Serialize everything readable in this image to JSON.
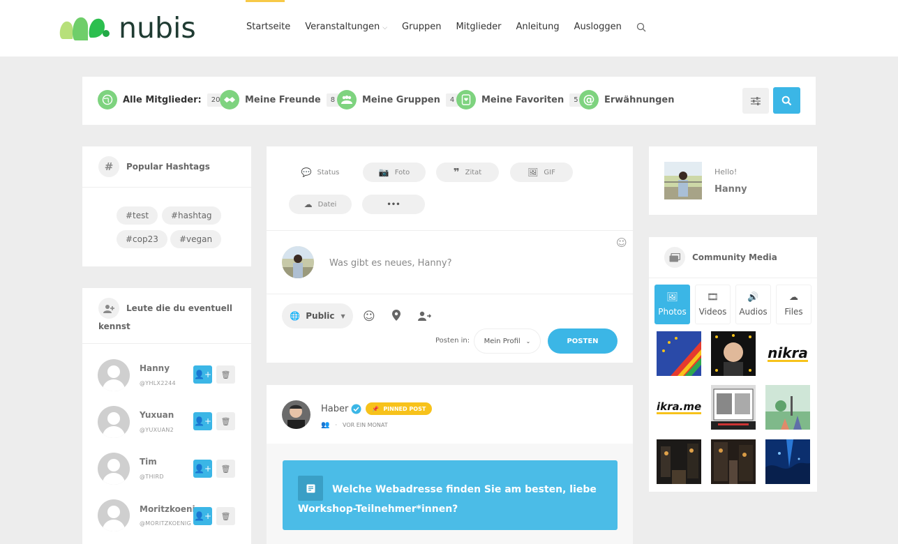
{
  "header": {
    "logo_text": "nubis",
    "nav": [
      {
        "label": "Startseite"
      },
      {
        "label": "Veranstaltungen",
        "has_dropdown": true
      },
      {
        "label": "Gruppen"
      },
      {
        "label": "Mitglieder"
      },
      {
        "label": "Anleitung"
      },
      {
        "label": "Ausloggen"
      }
    ],
    "search_icon": "search-icon",
    "accent": "#f7c948"
  },
  "members_bar": {
    "items": [
      {
        "label": "Alle Mitglieder:",
        "count": "20",
        "icon": "globe-icon"
      },
      {
        "label": "Meine Freunde",
        "count": "8",
        "icon": "handshake-icon"
      },
      {
        "label": "Meine Gruppen",
        "count": "4",
        "icon": "group-icon"
      },
      {
        "label": "Meine Favoriten",
        "count": "5",
        "icon": "favorite-icon"
      },
      {
        "label": "Erwähnungen",
        "icon": "at-icon"
      }
    ],
    "filter_icon": "sliders-icon",
    "search_icon": "search-icon",
    "accent_green": "#7ed37f",
    "accent_blue": "#3bb6e6"
  },
  "hashtags": {
    "title": "Popular Hashtags",
    "tags": [
      "#test",
      "#hashtag",
      "#cop23",
      "#vegan"
    ]
  },
  "suggestions": {
    "title_line1": "Leute die du eventuell",
    "title_line2": "kennst",
    "people": [
      {
        "name": "Hanny",
        "handle": "@YHLX2244"
      },
      {
        "name": "Yuxuan",
        "handle": "@YUXUAN2"
      },
      {
        "name": "Tim",
        "handle": "@THIRD"
      },
      {
        "name": "Moritzkoenig",
        "handle": "@MORITZKOENIG"
      }
    ]
  },
  "composer": {
    "types": [
      "Status",
      "Foto",
      "Zitat",
      "GIF",
      "Datei",
      "•••"
    ],
    "placeholder": "Was gibt es neues, Hanny?",
    "privacy": "Public",
    "posten_in_label": "Posten in:",
    "target": "Mein Profil",
    "submit": "POSTEN"
  },
  "post": {
    "author": "Haber",
    "badge": "PINNED POST",
    "time": "VOR EIN MONAT",
    "separator": "·",
    "question": "Welche Webadresse finden Sie am besten, liebe Workshop-Teilnehmer*innen?"
  },
  "profile_card": {
    "greeting": "Hello!",
    "name": "Hanny"
  },
  "community_media": {
    "title": "Community Media",
    "tabs": [
      "Photos",
      "Videos",
      "Audios",
      "Files"
    ],
    "active_tab": "Photos",
    "thumb_text": [
      "nikra",
      "ikra.medi"
    ]
  }
}
